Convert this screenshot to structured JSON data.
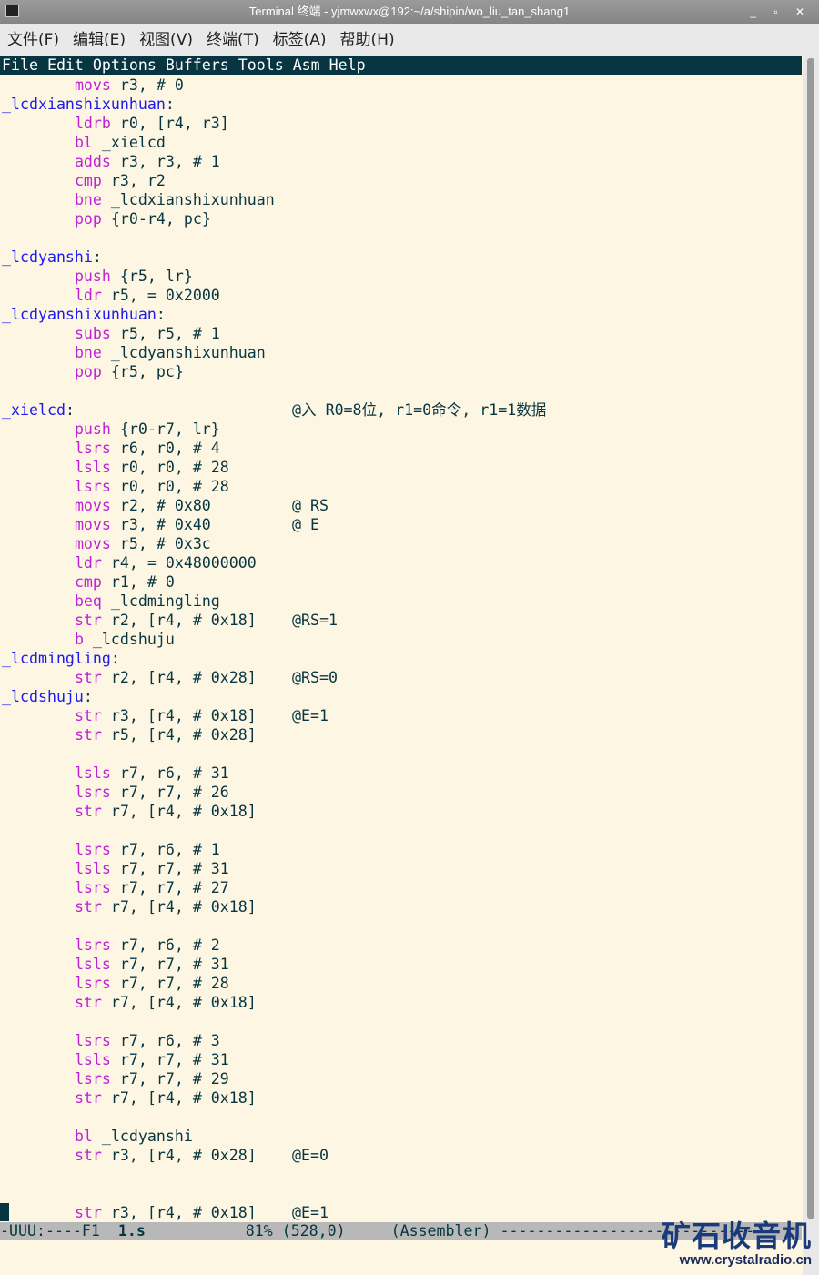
{
  "window": {
    "title": "Terminal 终端 - yjmwxwx@192:~/a/shipin/wo_liu_tan_shang1",
    "controls": "_ ▫ ✕"
  },
  "menubar": [
    "文件(F)",
    "编辑(E)",
    "视图(V)",
    "终端(T)",
    "标签(A)",
    "帮助(H)"
  ],
  "emacs_menu": "File Edit Options Buffers Tools Asm Help",
  "lines": [
    {
      "i": "movs",
      "a": " r3, # 0"
    },
    {
      "l": "_lcdxianshixunhuan"
    },
    {
      "i": "ldrb",
      "a": " r0, [r4, r3]"
    },
    {
      "i": "bl",
      "a": " _xielcd"
    },
    {
      "i": "adds",
      "a": " r3, r3, # 1"
    },
    {
      "i": "cmp",
      "a": " r3, r2"
    },
    {
      "i": "bne",
      "a": " _lcdxianshixunhuan"
    },
    {
      "i": "pop",
      "a": " {r0-r4, pc}"
    },
    {},
    {
      "l": "_lcdyanshi"
    },
    {
      "i": "push",
      "a": " {r5, lr}"
    },
    {
      "i": "ldr",
      "a": " r5, = 0x2000"
    },
    {
      "l": "_lcdyanshixunhuan"
    },
    {
      "i": "subs",
      "a": " r5, r5, # 1"
    },
    {
      "i": "bne",
      "a": " _lcdyanshixunhuan"
    },
    {
      "i": "pop",
      "a": " {r5, pc}"
    },
    {},
    {
      "l": "_xielcd",
      "c": "@入 R0=8位, r1=0命令, r1=1数据"
    },
    {
      "i": "push",
      "a": " {r0-r7, lr}"
    },
    {
      "i": "lsrs",
      "a": " r6, r0, # 4"
    },
    {
      "i": "lsls",
      "a": " r0, r0, # 28"
    },
    {
      "i": "lsrs",
      "a": " r0, r0, # 28"
    },
    {
      "i": "movs",
      "a": " r2, # 0x80",
      "c": "@ RS"
    },
    {
      "i": "movs",
      "a": " r3, # 0x40",
      "c": "@ E"
    },
    {
      "i": "movs",
      "a": " r5, # 0x3c"
    },
    {
      "i": "ldr",
      "a": " r4, = 0x48000000"
    },
    {
      "i": "cmp",
      "a": " r1, # 0"
    },
    {
      "i": "beq",
      "a": " _lcdmingling"
    },
    {
      "i": "str",
      "a": " r2, [r4, # 0x18]",
      "c": "@RS=1"
    },
    {
      "i": "b",
      "a": " _lcdshuju"
    },
    {
      "l": "_lcdmingling"
    },
    {
      "i": "str",
      "a": " r2, [r4, # 0x28]",
      "c": "@RS=0"
    },
    {
      "l": "_lcdshuju"
    },
    {
      "i": "str",
      "a": " r3, [r4, # 0x18]",
      "c": "@E=1"
    },
    {
      "i": "str",
      "a": " r5, [r4, # 0x28]"
    },
    {},
    {
      "i": "lsls",
      "a": " r7, r6, # 31"
    },
    {
      "i": "lsrs",
      "a": " r7, r7, # 26"
    },
    {
      "i": "str",
      "a": " r7, [r4, # 0x18]"
    },
    {},
    {
      "i": "lsrs",
      "a": " r7, r6, # 1"
    },
    {
      "i": "lsls",
      "a": " r7, r7, # 31"
    },
    {
      "i": "lsrs",
      "a": " r7, r7, # 27"
    },
    {
      "i": "str",
      "a": " r7, [r4, # 0x18]"
    },
    {},
    {
      "i": "lsrs",
      "a": " r7, r6, # 2"
    },
    {
      "i": "lsls",
      "a": " r7, r7, # 31"
    },
    {
      "i": "lsrs",
      "a": " r7, r7, # 28"
    },
    {
      "i": "str",
      "a": " r7, [r4, # 0x18]"
    },
    {},
    {
      "i": "lsrs",
      "a": " r7, r6, # 3"
    },
    {
      "i": "lsls",
      "a": " r7, r7, # 31"
    },
    {
      "i": "lsrs",
      "a": " r7, r7, # 29"
    },
    {
      "i": "str",
      "a": " r7, [r4, # 0x18]"
    },
    {},
    {
      "i": "bl",
      "a": " _lcdyanshi"
    },
    {
      "i": "str",
      "a": " r3, [r4, # 0x28]",
      "c": "@E=0"
    },
    {},
    {},
    {
      "i": "str",
      "a": " r3, [r4, # 0x18]",
      "c": "@E=1"
    }
  ],
  "modeline": {
    "status": "-UUU:----F1  ",
    "buffer": "1.s",
    "position": "           81% (528,0)     (Assembler) -------------------------------"
  },
  "watermark": {
    "logo": "矿石收音机",
    "url": "www.crystalradio.cn"
  },
  "colors": {
    "background": "#fdf6e3",
    "label": "#1a1aee",
    "keyword": "#c020d8",
    "text": "#073642"
  }
}
